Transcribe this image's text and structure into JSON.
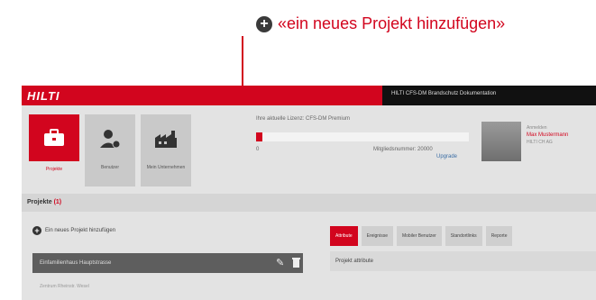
{
  "callout": {
    "text": "«ein neues Projekt hinzufügen»"
  },
  "header": {
    "logo": "HILTI",
    "title": "HILTI CFS-DM Brandschutz Dokumentation"
  },
  "nav": {
    "tiles": [
      {
        "label": "Projekte",
        "icon": "briefcase-icon"
      },
      {
        "label": "Benutzer",
        "icon": "user-settings-icon"
      },
      {
        "label": "Mein Unternehmen",
        "icon": "factory-icon"
      }
    ]
  },
  "license": {
    "line": "Ihre aktuelle Lizenz: CFS-DM Premium",
    "progress": 0.03,
    "min": "0",
    "member": "Mitgliedsnummer: 20000",
    "link": "Upgrade"
  },
  "user": {
    "role": "Anmelden",
    "name": "Max Mustermann",
    "company": "HILTI CH AG"
  },
  "projects": {
    "title": "Projekte",
    "count": "(1)"
  },
  "add_project": {
    "label": "Ein neues Projekt hinzufügen"
  },
  "project_row": {
    "name": "Einfamilienhaus Hauptstrasse",
    "next": "Zentrum Rheinstr. Wesel"
  },
  "tabs": [
    "Attribute",
    "Ereignisse",
    "Mobiler Benutzer",
    "Standortlinks",
    "Reporte"
  ],
  "panel": {
    "title": "Projekt attribute"
  }
}
